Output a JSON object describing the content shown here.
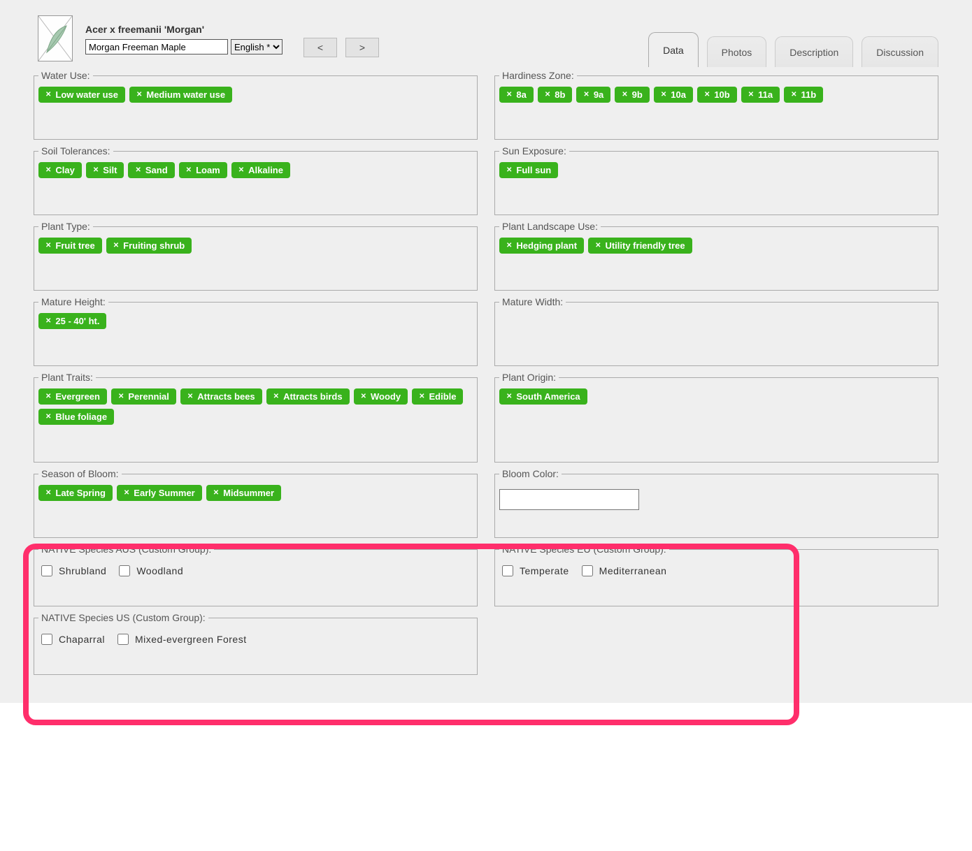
{
  "header": {
    "title": "Acer x freemanii 'Morgan'",
    "common_name": "Morgan Freeman Maple",
    "language": "English *",
    "prev": "<",
    "next": ">"
  },
  "tabs": [
    {
      "label": "Data",
      "active": true
    },
    {
      "label": "Photos",
      "active": false
    },
    {
      "label": "Description",
      "active": false
    },
    {
      "label": "Discussion",
      "active": false
    }
  ],
  "groups": {
    "water_use": {
      "legend": "Water Use:",
      "tags": [
        "Low water use",
        "Medium water use"
      ]
    },
    "hardiness_zone": {
      "legend": "Hardiness Zone:",
      "tags": [
        "8a",
        "8b",
        "9a",
        "9b",
        "10a",
        "10b",
        "11a",
        "11b"
      ]
    },
    "soil_tolerances": {
      "legend": "Soil Tolerances:",
      "tags": [
        "Clay",
        "Silt",
        "Sand",
        "Loam",
        "Alkaline"
      ]
    },
    "sun_exposure": {
      "legend": "Sun Exposure:",
      "tags": [
        "Full sun"
      ]
    },
    "plant_type": {
      "legend": "Plant Type:",
      "tags": [
        "Fruit tree",
        "Fruiting shrub"
      ]
    },
    "plant_landscape_use": {
      "legend": "Plant Landscape Use:",
      "tags": [
        "Hedging plant",
        "Utility friendly tree"
      ]
    },
    "mature_height": {
      "legend": "Mature Height:",
      "tags": [
        "25 - 40' ht."
      ]
    },
    "mature_width": {
      "legend": "Mature Width:",
      "tags": []
    },
    "plant_traits": {
      "legend": "Plant Traits:",
      "tags": [
        "Evergreen",
        "Perennial",
        "Attracts bees",
        "Attracts birds",
        "Woody",
        "Edible",
        "Blue foliage"
      ]
    },
    "plant_origin": {
      "legend": "Plant Origin:",
      "tags": [
        "South America"
      ]
    },
    "season_of_bloom": {
      "legend": "Season of Bloom:",
      "tags": [
        "Late Spring",
        "Early Summer",
        "Midsummer"
      ]
    },
    "bloom_color": {
      "legend": "Bloom Color:"
    },
    "native_aus": {
      "legend": "NATIVE Species AUS (Custom Group):",
      "options": [
        "Shrubland",
        "Woodland"
      ]
    },
    "native_eu": {
      "legend": "NATIVE Species EU (Custom Group):",
      "options": [
        "Temperate",
        "Mediterranean"
      ]
    },
    "native_us": {
      "legend": "NATIVE Species US (Custom Group):",
      "options": [
        "Chaparral",
        "Mixed-evergreen Forest"
      ]
    }
  },
  "x_glyph": "✕"
}
